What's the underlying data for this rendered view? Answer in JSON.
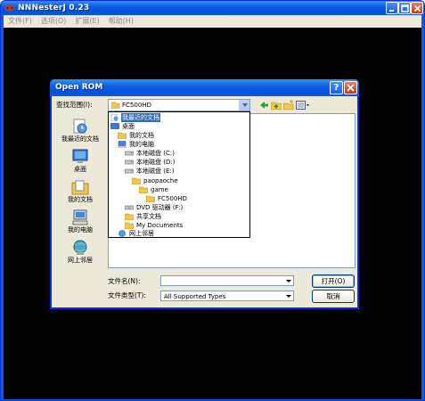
{
  "app": {
    "title": "NNNesterJ 0.23",
    "menu": [
      "文件(F)",
      "选项(O)",
      "扩展(E)",
      "帮助(H)"
    ]
  },
  "dialog": {
    "title": "Open ROM",
    "look_in_label": "查找范围(I):",
    "look_in_value": "FC500HD",
    "places": [
      {
        "icon": "recent-documents-icon",
        "label": "我最近的文档"
      },
      {
        "icon": "desktop-icon",
        "label": "桌面"
      },
      {
        "icon": "my-documents-icon",
        "label": "我的文档"
      },
      {
        "icon": "my-computer-icon",
        "label": "我的电脑"
      },
      {
        "icon": "network-places-icon",
        "label": "网上邻居"
      }
    ],
    "look_in_options": [
      {
        "label": "我最近的文档",
        "icon": "recent-documents-icon",
        "selected": true
      },
      {
        "label": "桌面",
        "icon": "desktop-icon"
      },
      {
        "label": "我的文档",
        "icon": "my-documents-icon"
      },
      {
        "label": "我的电脑",
        "icon": "my-computer-icon"
      },
      {
        "label": "本地磁盘 (C:)",
        "icon": "drive-icon"
      },
      {
        "label": "本地磁盘 (D:)",
        "icon": "drive-icon"
      },
      {
        "label": "本地磁盘 (E:)",
        "icon": "drive-icon"
      },
      {
        "label": "paopaoche",
        "icon": "folder-icon"
      },
      {
        "label": "game",
        "icon": "folder-icon"
      },
      {
        "label": "FC500HD",
        "icon": "folder-open-icon"
      },
      {
        "label": "DVD 驱动器 (F:)",
        "icon": "dvd-icon"
      },
      {
        "label": "共享文档",
        "icon": "folder-icon"
      },
      {
        "label": "My Documents",
        "icon": "folder-icon"
      },
      {
        "label": "网上邻居",
        "icon": "network-places-icon"
      }
    ],
    "file_name_label": "文件名(N):",
    "file_name_value": "",
    "file_type_label": "文件类型(T):",
    "file_type_value": "All Supported Types",
    "open_button": "打开(O)",
    "cancel_button": "取消",
    "help_button": "?"
  },
  "colors": {
    "titlebar": "#0a5fe0",
    "dialog_face": "#ece9d8",
    "selection": "#316ac5",
    "canvas": "#000000"
  }
}
